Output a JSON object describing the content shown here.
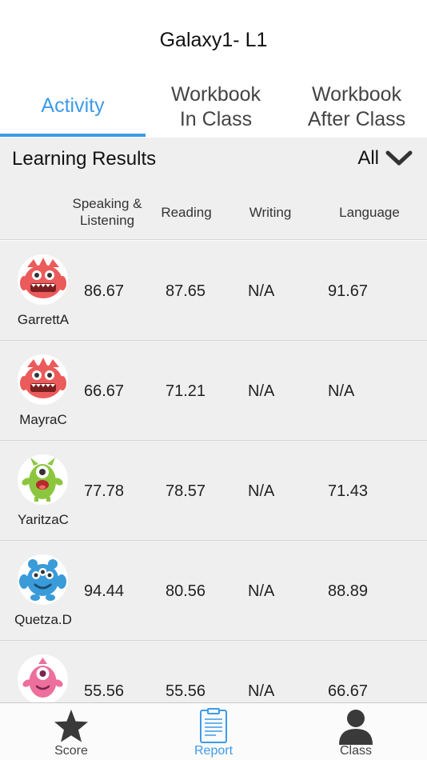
{
  "header": {
    "title": "Galaxy1- L1"
  },
  "tabs": [
    {
      "line1": "Activity",
      "line2": ""
    },
    {
      "line1": "Workbook",
      "line2": "In Class"
    },
    {
      "line1": "Workbook",
      "line2": "After Class"
    }
  ],
  "active_tab": 0,
  "results": {
    "title": "Learning Results",
    "filter_label": "All"
  },
  "columns": {
    "c1_line1": "Speaking &",
    "c1_line2": "Listening",
    "c2": "Reading",
    "c3": "Writing",
    "c4": "Language"
  },
  "rows": [
    {
      "name": "GarrettA",
      "avatar": "red-monster-avatar",
      "speaking": "86.67",
      "reading": "87.65",
      "writing": "N/A",
      "language": "91.67"
    },
    {
      "name": "MayraC",
      "avatar": "red-monster-avatar",
      "speaking": "66.67",
      "reading": "71.21",
      "writing": "N/A",
      "language": "N/A"
    },
    {
      "name": "YaritzaC",
      "avatar": "green-monster-avatar",
      "speaking": "77.78",
      "reading": "78.57",
      "writing": "N/A",
      "language": "71.43"
    },
    {
      "name": "Quetza.D",
      "avatar": "blue-monster-avatar",
      "speaking": "94.44",
      "reading": "80.56",
      "writing": "N/A",
      "language": "88.89"
    },
    {
      "name": "",
      "avatar": "pink-monster-avatar",
      "speaking": "55.56",
      "reading": "55.56",
      "writing": "N/A",
      "language": "66.67"
    }
  ],
  "tabbar": [
    {
      "label": "Score",
      "icon": "star-icon"
    },
    {
      "label": "Report",
      "icon": "report-icon"
    },
    {
      "label": "Class",
      "icon": "person-icon"
    }
  ],
  "colors": {
    "accent": "#3d9be9",
    "section_bg": "#efefef",
    "red_monster": "#ec5b5b",
    "green_monster": "#8cc63f",
    "blue_monster": "#3a9bd9",
    "pink_monster": "#ec6f9c"
  }
}
